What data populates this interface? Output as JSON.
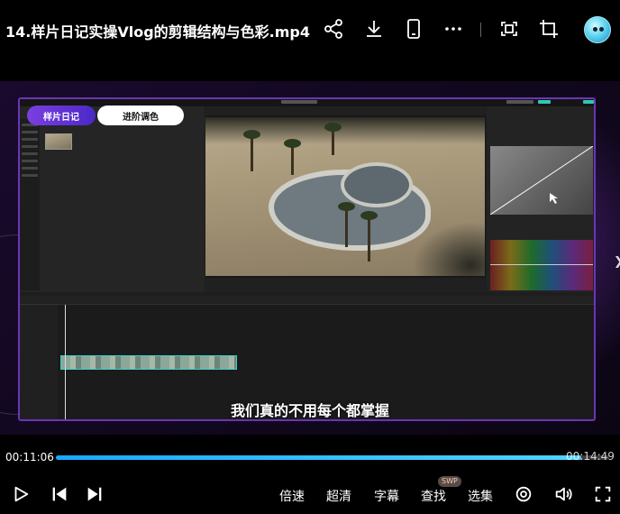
{
  "header": {
    "title": "14.样片日记实操Vlog的剪辑结构与色彩.mp4",
    "icons": [
      "share-icon",
      "download-icon",
      "phone-icon",
      "more-icon",
      "pip-icon",
      "crop-icon"
    ]
  },
  "video": {
    "overlay_buttons": [
      "样片日记",
      "进阶调色"
    ],
    "subtitle": "我们真的不用每个都掌握"
  },
  "player": {
    "current_time": "00:11:06",
    "duration": "00:14:49",
    "progress": 0.95,
    "accent": "#1aa7ff",
    "controls": {
      "speed": "倍速",
      "quality": "超清",
      "subtitles": "字幕",
      "search": "查找",
      "search_badge": "SWP",
      "episodes": "选集"
    }
  }
}
